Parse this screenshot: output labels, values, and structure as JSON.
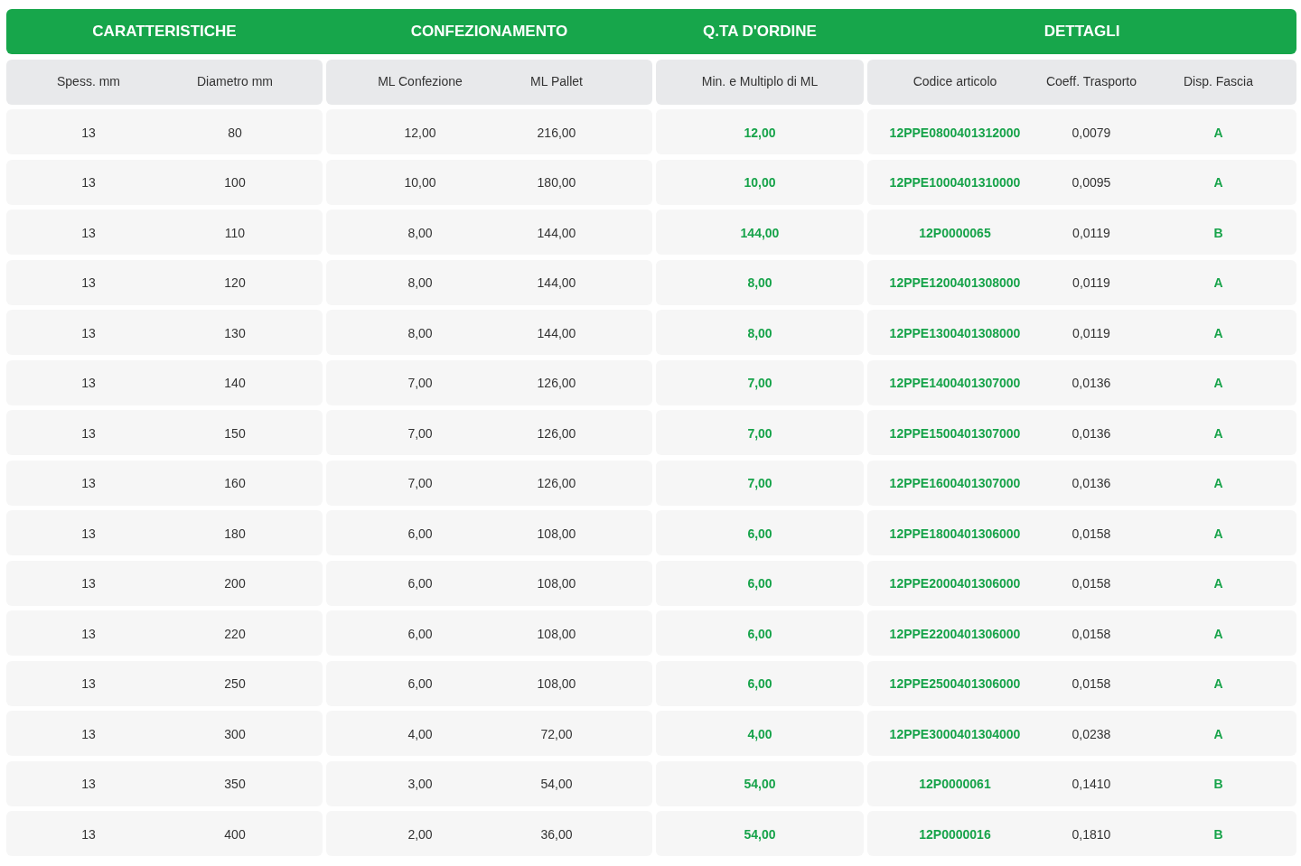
{
  "groups": [
    {
      "title": "CARATTERISTICHE",
      "columns": [
        {
          "label": "Spess. mm",
          "kind": "plain"
        },
        {
          "label": "Diametro mm",
          "kind": "plain"
        }
      ]
    },
    {
      "title": "CONFEZIONAMENTO",
      "columns": [
        {
          "label": "ML Confezione",
          "kind": "plain"
        },
        {
          "label": "ML Pallet",
          "kind": "plain"
        }
      ]
    },
    {
      "title": "Q.TA D'ORDINE",
      "columns": [
        {
          "label": "Min. e Multiplo di ML",
          "kind": "highlight"
        }
      ]
    },
    {
      "title": "DETTAGLI",
      "columns": [
        {
          "label": "Codice articolo",
          "kind": "highlight"
        },
        {
          "label": "Coeff. Trasporto",
          "kind": "plain"
        },
        {
          "label": "Disp. Fascia",
          "kind": "highlight"
        }
      ]
    }
  ],
  "rows": [
    [
      "13",
      "80",
      "12,00",
      "216,00",
      "12,00",
      "12PPE0800401312000",
      "0,0079",
      "A"
    ],
    [
      "13",
      "100",
      "10,00",
      "180,00",
      "10,00",
      "12PPE1000401310000",
      "0,0095",
      "A"
    ],
    [
      "13",
      "110",
      "8,00",
      "144,00",
      "144,00",
      "12P0000065",
      "0,0119",
      "B"
    ],
    [
      "13",
      "120",
      "8,00",
      "144,00",
      "8,00",
      "12PPE1200401308000",
      "0,0119",
      "A"
    ],
    [
      "13",
      "130",
      "8,00",
      "144,00",
      "8,00",
      "12PPE1300401308000",
      "0,0119",
      "A"
    ],
    [
      "13",
      "140",
      "7,00",
      "126,00",
      "7,00",
      "12PPE1400401307000",
      "0,0136",
      "A"
    ],
    [
      "13",
      "150",
      "7,00",
      "126,00",
      "7,00",
      "12PPE1500401307000",
      "0,0136",
      "A"
    ],
    [
      "13",
      "160",
      "7,00",
      "126,00",
      "7,00",
      "12PPE1600401307000",
      "0,0136",
      "A"
    ],
    [
      "13",
      "180",
      "6,00",
      "108,00",
      "6,00",
      "12PPE1800401306000",
      "0,0158",
      "A"
    ],
    [
      "13",
      "200",
      "6,00",
      "108,00",
      "6,00",
      "12PPE2000401306000",
      "0,0158",
      "A"
    ],
    [
      "13",
      "220",
      "6,00",
      "108,00",
      "6,00",
      "12PPE2200401306000",
      "0,0158",
      "A"
    ],
    [
      "13",
      "250",
      "6,00",
      "108,00",
      "6,00",
      "12PPE2500401306000",
      "0,0158",
      "A"
    ],
    [
      "13",
      "300",
      "4,00",
      "72,00",
      "4,00",
      "12PPE3000401304000",
      "0,0238",
      "A"
    ],
    [
      "13",
      "350",
      "3,00",
      "54,00",
      "54,00",
      "12P0000061",
      "0,1410",
      "B"
    ],
    [
      "13",
      "400",
      "2,00",
      "36,00",
      "54,00",
      "12P0000016",
      "0,1810",
      "B"
    ]
  ]
}
